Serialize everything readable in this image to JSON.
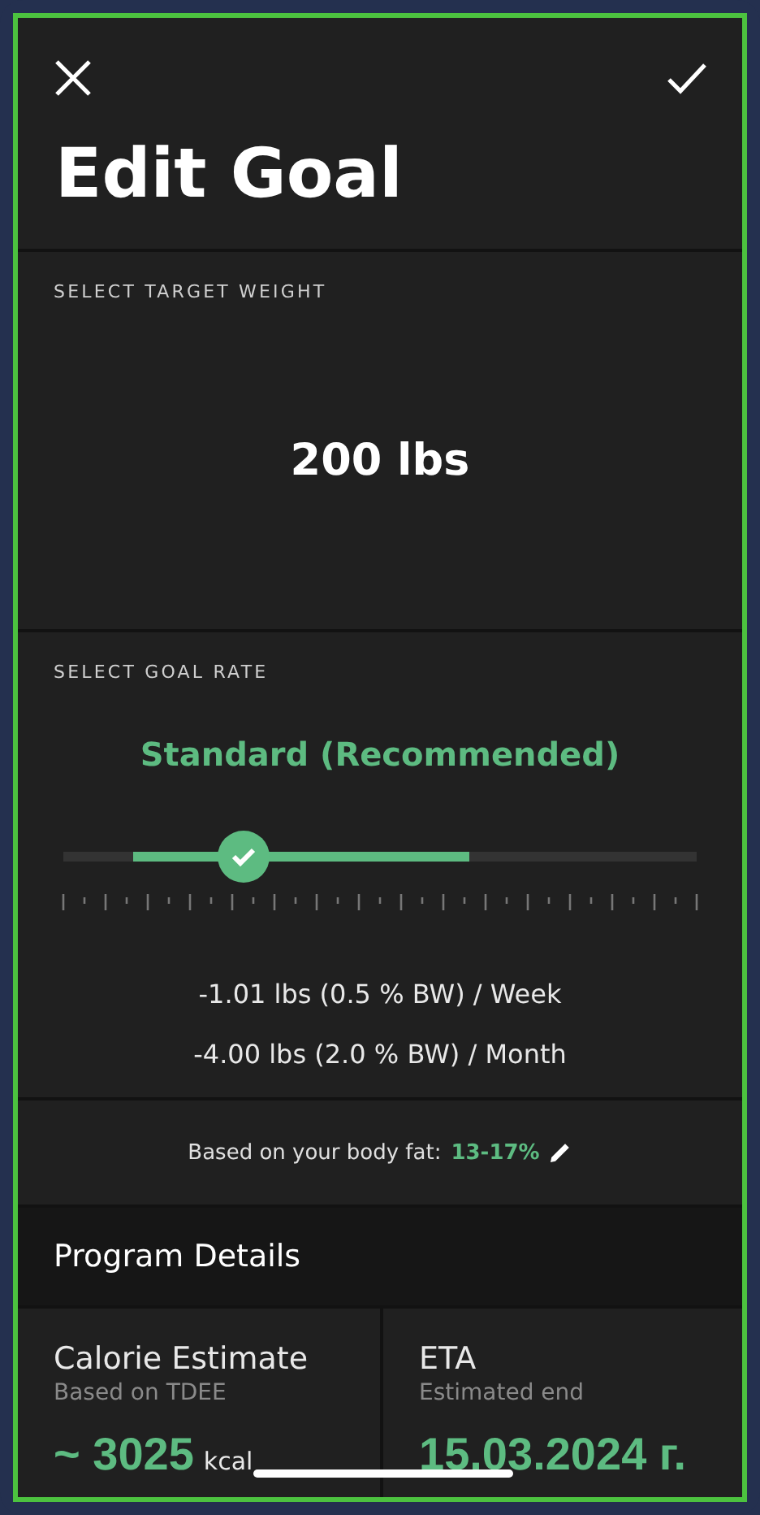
{
  "header": {
    "title": "Edit Goal"
  },
  "target_weight": {
    "label": "SELECT TARGET WEIGHT",
    "value": "200 lbs"
  },
  "goal_rate": {
    "label": "SELECT GOAL RATE",
    "rate_name": "Standard (Recommended)",
    "slider": {
      "level": 0.285
    },
    "lines": [
      "-1.01 lbs (0.5 % BW) / Week",
      "-4.00 lbs (2.0 % BW) / Month"
    ]
  },
  "body_fat": {
    "label": "Based on your body fat:",
    "value": "13-17%"
  },
  "program_details": {
    "title": "Program Details",
    "cards": [
      {
        "title": "Calorie Estimate",
        "subtitle": "Based on TDEE",
        "value": "~ 3025",
        "unit": "kcal"
      },
      {
        "title": "ETA",
        "subtitle": "Estimated end",
        "value": "15.03.2024 г."
      }
    ]
  }
}
